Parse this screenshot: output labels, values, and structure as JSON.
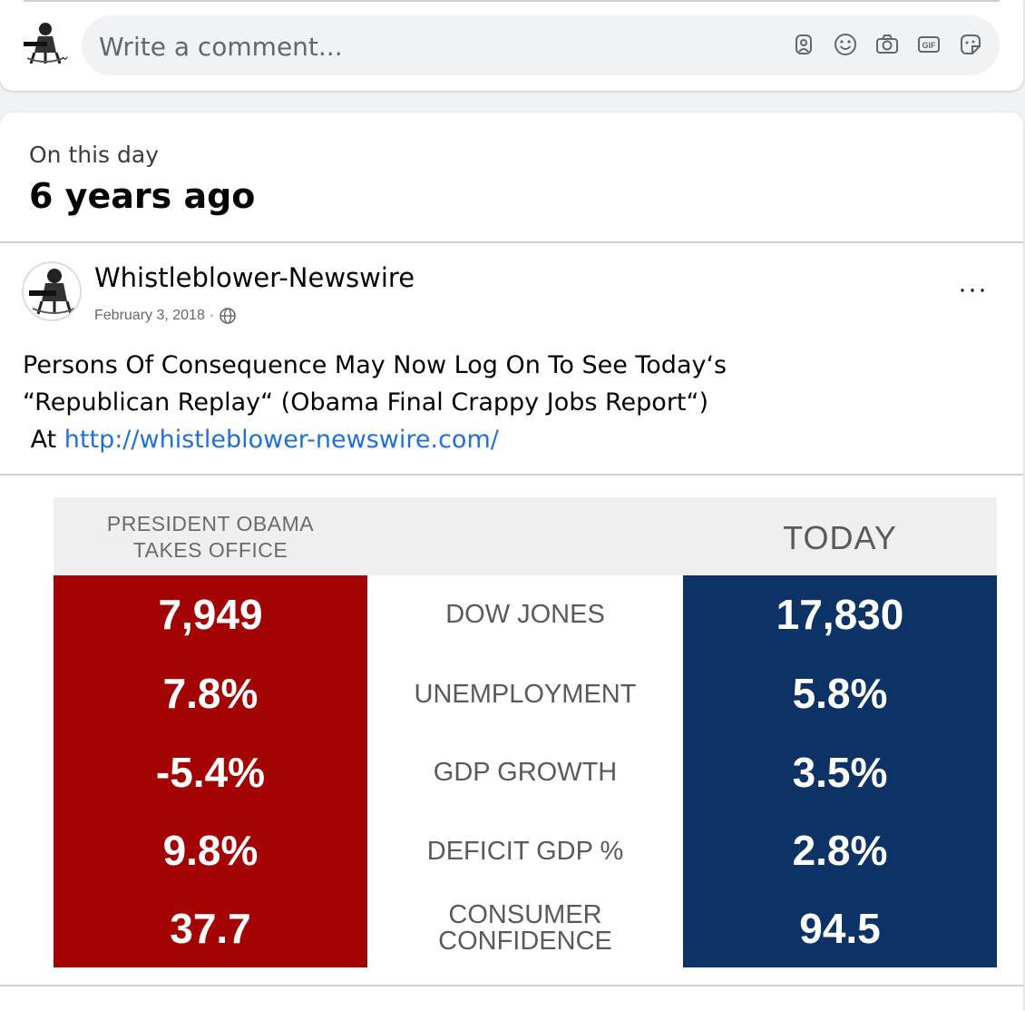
{
  "comment_box": {
    "placeholder": "Write a comment...",
    "icons": [
      "avatar-icon",
      "emoji-icon",
      "camera-icon",
      "gif-icon",
      "sticker-icon"
    ]
  },
  "memory": {
    "label": "On this day",
    "title": "6 years ago"
  },
  "post": {
    "author": "Whistleblower-Newswire",
    "date": "February 3, 2018",
    "separator": "·",
    "audience_icon": "globe-icon",
    "text_line1": "Persons Of Consequence May Now Log On To See Today‘s",
    "text_line2": "“Republican Replay“ (Obama Final Crappy Jobs Report“)",
    "text_prefix": "At",
    "link": "http://whistleblower-newswire.com/",
    "more_label": "···"
  },
  "infographic": {
    "header_left_line1": "PRESIDENT OBAMA",
    "header_left_line2": "TAKES OFFICE",
    "header_right": "TODAY",
    "rows": [
      {
        "label": "DOW JONES",
        "left": "7,949",
        "right": "17,830"
      },
      {
        "label": "UNEMPLOYMENT",
        "left": "7.8%",
        "right": "5.8%"
      },
      {
        "label": "GDP GROWTH",
        "left": "-5.4%",
        "right": "3.5%"
      },
      {
        "label": "DEFICIT GDP %",
        "left": "9.8%",
        "right": "2.8%"
      },
      {
        "label_line1": "CONSUMER",
        "label_line2": "CONFIDENCE",
        "left": "37.7",
        "right": "94.5"
      }
    ],
    "colors": {
      "left_panel": "#a40303",
      "right_panel": "#0c3266",
      "header": "#efefef"
    }
  }
}
